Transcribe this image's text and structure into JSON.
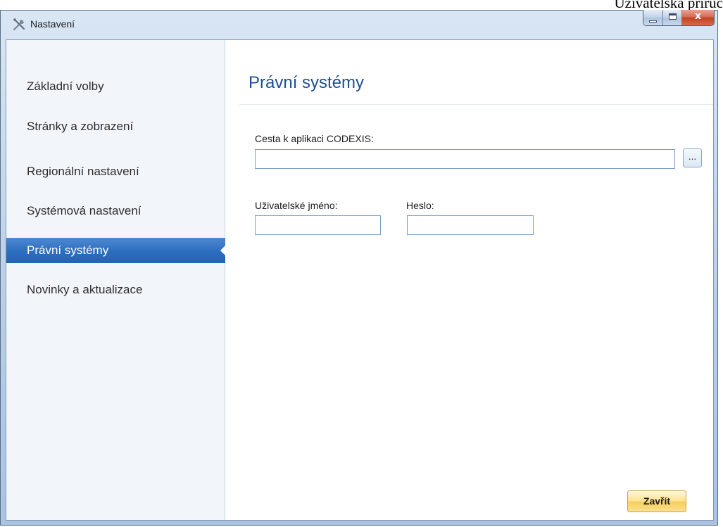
{
  "document_header": "Uživatelská příruč",
  "window": {
    "title": "Nastavení",
    "icon": "tools-icon",
    "controls": {
      "minimize": "minimize-icon",
      "maximize": "maximize-icon",
      "close": "x"
    }
  },
  "sidebar": {
    "items": [
      {
        "label": "Základní volby",
        "active": false
      },
      {
        "label": "Stránky a zobrazení",
        "active": false
      },
      {
        "label": "Regionální nastavení",
        "active": false
      },
      {
        "label": "Systémová nastavení",
        "active": false
      },
      {
        "label": "Právní systémy",
        "active": true
      },
      {
        "label": "Novinky a aktualizace",
        "active": false
      }
    ]
  },
  "main": {
    "title": "Právní systémy",
    "codexis_path": {
      "label": "Cesta k aplikaci CODEXIS:",
      "value": "",
      "browse_label": "..."
    },
    "username": {
      "label": "Uživatelské jméno:",
      "value": ""
    },
    "password": {
      "label": "Heslo:",
      "value": ""
    },
    "close_button": "Zavřít"
  },
  "colors": {
    "accent_selected": "#2e6fc0",
    "title_text": "#1e4f8f",
    "close_button_bg": "#fde28c"
  }
}
